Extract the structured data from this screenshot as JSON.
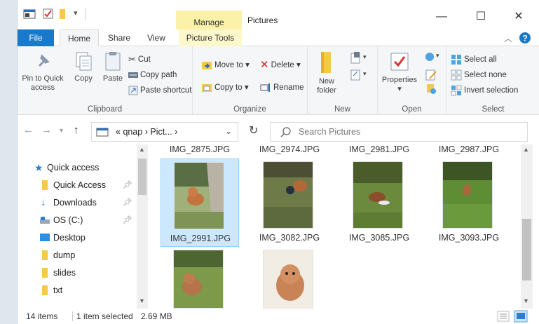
{
  "window": {
    "title": "Pictures",
    "contextual_tab": "Manage",
    "controls": [
      "—",
      "☐",
      "✕"
    ]
  },
  "ribbon_tabs": {
    "file": "File",
    "home": "Home",
    "share": "Share",
    "view": "View",
    "picture_tools": "Picture Tools"
  },
  "ribbon": {
    "clipboard": {
      "label": "Clipboard",
      "pin_line1": "Pin to Quick",
      "pin_line2": "access",
      "copy": "Copy",
      "paste": "Paste",
      "cut": "Cut",
      "copy_path": "Copy path",
      "paste_shortcut": "Paste shortcut"
    },
    "organize": {
      "label": "Organize",
      "move_to": "Move to ▾",
      "copy_to": "Copy to ▾",
      "delete": "Delete ▾",
      "rename": "Rename"
    },
    "new": {
      "label": "New",
      "new_folder_line1": "New",
      "new_folder_line2": "folder"
    },
    "open": {
      "label": "Open",
      "properties": "Properties",
      "properties_arrow": "▾"
    },
    "select": {
      "label": "Select",
      "select_all": "Select all",
      "select_none": "Select none",
      "invert_selection": "Invert selection"
    }
  },
  "address": {
    "path_prefix": "«",
    "crumb1": "qnap",
    "crumb2": "Pict...",
    "separator": "›",
    "search_placeholder": "Search Pictures"
  },
  "navpane": {
    "items": [
      {
        "label": "Quick access",
        "icon": "star-icon"
      },
      {
        "label": "Quick Access",
        "icon": "folder-icon",
        "pinned": true
      },
      {
        "label": "Downloads",
        "icon": "download-icon",
        "pinned": true
      },
      {
        "label": "OS (C:)",
        "icon": "drive-icon",
        "pinned": true
      },
      {
        "label": "Desktop",
        "icon": "desktop-icon"
      },
      {
        "label": "dump",
        "icon": "folder-icon"
      },
      {
        "label": "slides",
        "icon": "folder-icon"
      },
      {
        "label": "txt",
        "icon": "folder-icon"
      }
    ]
  },
  "files": {
    "top_row_captions": [
      "IMG_2875.JPG",
      "IMG_2974.JPG",
      "IMG_2981.JPG",
      "IMG_2987.JPG"
    ],
    "items": [
      {
        "name": "IMG_2991.JPG",
        "selected": true
      },
      {
        "name": "IMG_3082.JPG",
        "selected": false
      },
      {
        "name": "IMG_3085.JPG",
        "selected": false
      },
      {
        "name": "IMG_3093.JPG",
        "selected": false
      },
      {
        "name": "",
        "selected": false
      },
      {
        "name": "",
        "selected": false
      }
    ]
  },
  "status": {
    "count": "14 items",
    "selection": "1 item selected",
    "size": "2.69 MB"
  },
  "colors": {
    "accent": "#1979ca",
    "selection": "#cce8ff",
    "manage_tab": "#fbf1a8"
  }
}
